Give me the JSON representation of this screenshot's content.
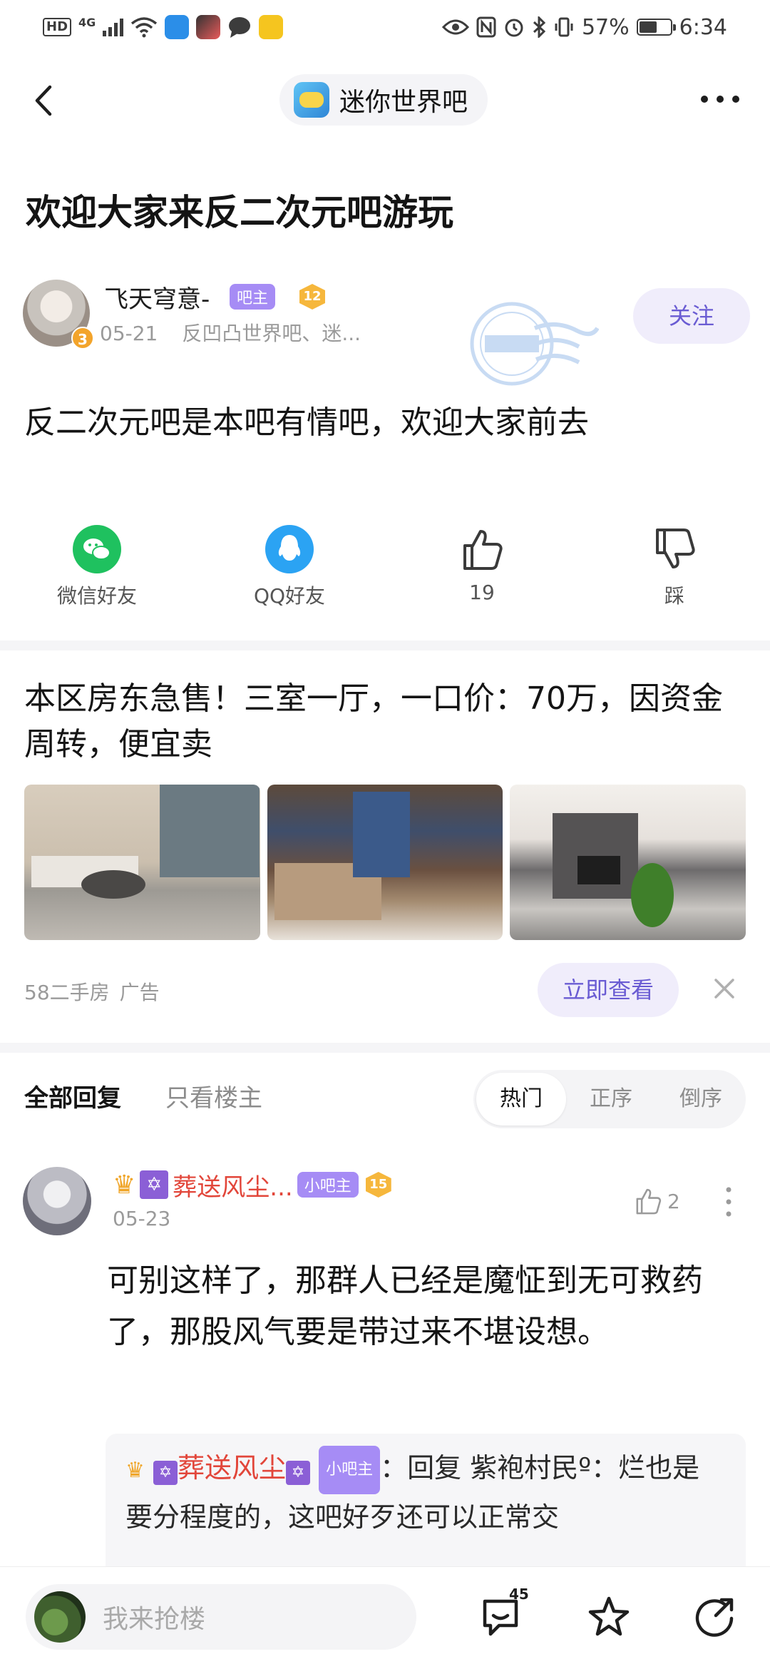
{
  "status_bar": {
    "hd": "HD",
    "network": "4G",
    "battery": "57%",
    "battery_level": 0.57,
    "time": "6:34"
  },
  "nav": {
    "forum_name": "迷你世界吧"
  },
  "thread": {
    "title": "欢迎大家来反二次元吧游玩",
    "author": {
      "name": "飞天穹意-",
      "role_tag": "吧主",
      "level": "12",
      "avatar_badge": "3",
      "date": "05-21",
      "source": "反凹凸世界吧、迷..."
    },
    "follow_label": "关注",
    "body": "反二次元吧是本吧有情吧，欢迎大家前去"
  },
  "share": {
    "wechat": "微信好友",
    "qq": "QQ好友",
    "like_count": "19",
    "dislike": "踩"
  },
  "ad": {
    "title": "本区房东急售！三室一厅，一口价：70万，因资金周转，便宜卖",
    "source": "58二手房",
    "ad_label": "广告",
    "cta": "立即查看"
  },
  "replies": {
    "tab_all": "全部回复",
    "tab_op": "只看楼主",
    "sort_hot": "热门",
    "sort_asc": "正序",
    "sort_desc": "倒序",
    "items": [
      {
        "name": "葬送风尘...",
        "role_tag": "小吧主",
        "level": "15",
        "date": "05-23",
        "likes": "2",
        "body": "可别这样了，那群人已经是魔怔到无可救药了，那股风气要是带过来不堪设想。",
        "sub_reply": {
          "name": "葬送风尘",
          "role_tag": "小吧主",
          "prefix": "：回复 紫袍村民º：",
          "text": "烂也是要分程度的，这吧好歹还可以正常交"
        }
      }
    ]
  },
  "bottom_bar": {
    "placeholder": "我来抢楼",
    "comment_count": "45"
  },
  "colors": {
    "accent_purple": "#6a5cd3",
    "tag_purple": "#a68cf5",
    "name_red": "#e2463a",
    "wechat_green": "#1fc15f",
    "qq_blue": "#2ba3f3"
  }
}
